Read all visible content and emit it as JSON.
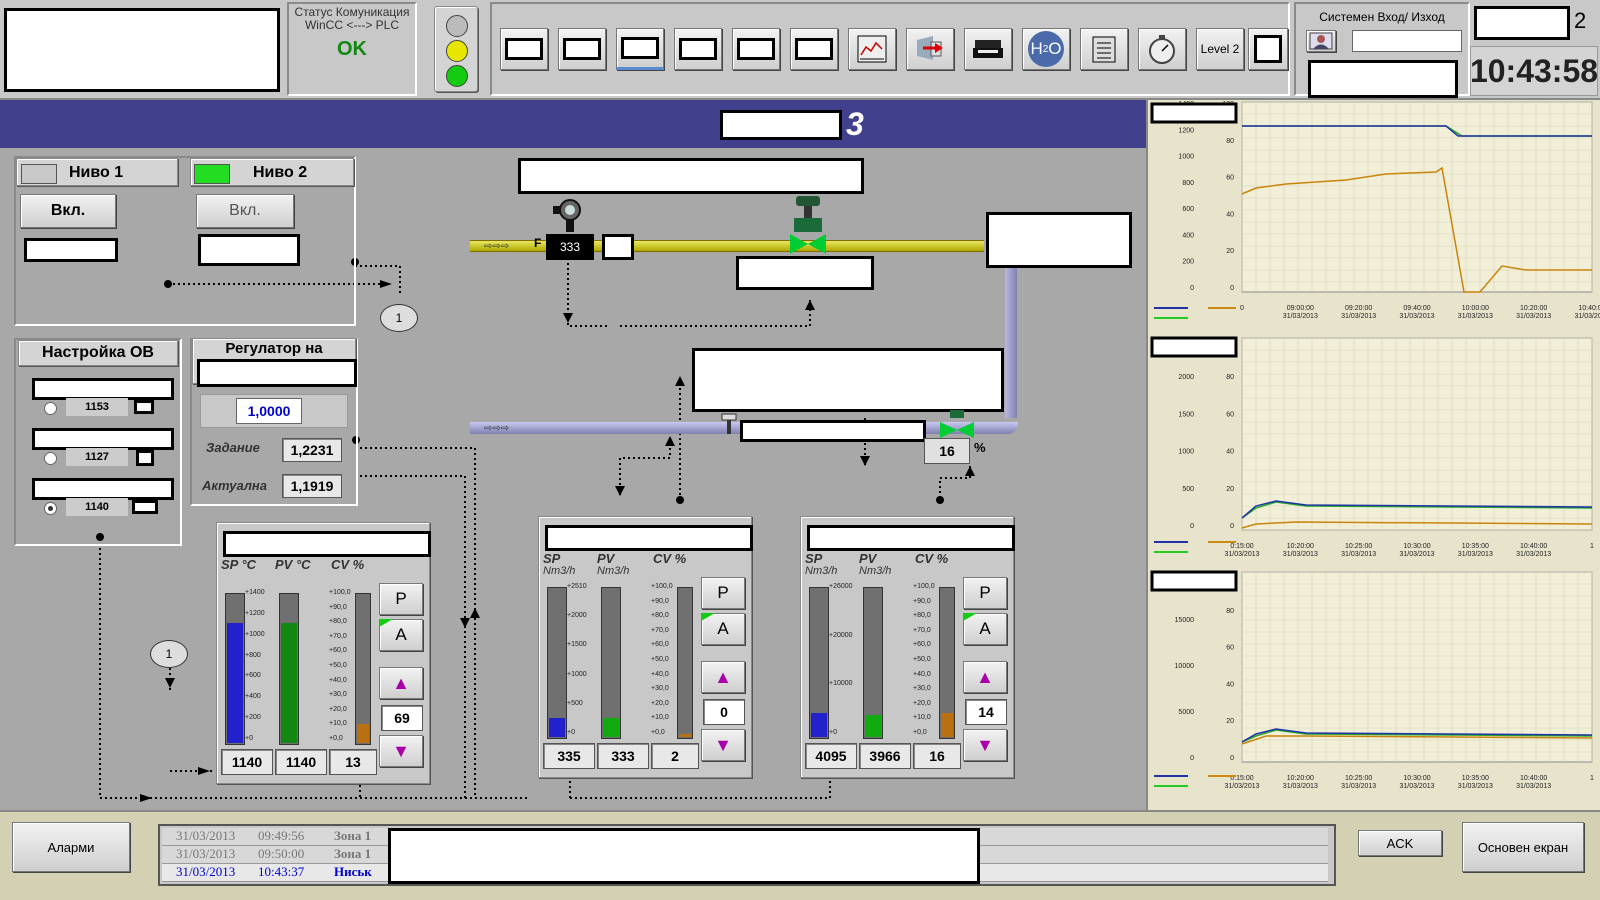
{
  "header": {
    "comm_status_title": "Статус Комуникация WinCC <---> PLC",
    "comm_status_value": "OK",
    "level_button": "Level 2",
    "system_io_label": "Системен Вход/ Изход",
    "station_number": "2",
    "clock": "10:43:58"
  },
  "banner": {
    "number": "3"
  },
  "levels": {
    "level1": {
      "title": "Ниво 1",
      "button": "Вкл.",
      "indicator_color": "#c8c8c8"
    },
    "level2": {
      "title": "Ниво 2",
      "button": "Вкл.",
      "indicator_color": "#22dd22"
    },
    "ref_circle": "1"
  },
  "ov_settings": {
    "title": "Настройка ОВ",
    "options": [
      {
        "value": "1153",
        "selected": false
      },
      {
        "value": "1127",
        "selected": false
      },
      {
        "value": "1140",
        "selected": true
      }
    ]
  },
  "regulator": {
    "title": "Регулатор на",
    "ratio": "1,0000",
    "setpoint_label": "Задание",
    "setpoint_value": "1,2231",
    "actual_label": "Актуална",
    "actual_value": "1,1919"
  },
  "process": {
    "flow_label": "F",
    "flow_value": "333",
    "valve_percent": "16",
    "percent_unit": "%",
    "ref_circle": "1"
  },
  "controllers": [
    {
      "sp_label": "SP °C",
      "pv_label": "PV °C",
      "cv_label": "CV %",
      "sp_unit": "",
      "pv_unit": "",
      "sp_scale": [
        "+1400",
        "+1200",
        "+1000",
        "+800",
        "+600",
        "+400",
        "+200",
        "+0"
      ],
      "cv_scale": [
        "+100,0",
        "+90,0",
        "+80,0",
        "+70,0",
        "+60,0",
        "+50,0",
        "+40,0",
        "+30,0",
        "+20,0",
        "+10,0",
        "+0,0"
      ],
      "sp": "1140",
      "pv": "1140",
      "cv": "13",
      "out": "69",
      "sp_fill": 0.81,
      "pv_fill": 0.81,
      "cv_fill": 0.13,
      "sp_color": "#2222cc",
      "pv_color": "#118811",
      "cv_color": "#b87010",
      "p": "P",
      "a": "A"
    },
    {
      "sp_label": "SP",
      "pv_label": "PV",
      "cv_label": "CV %",
      "sp_unit": "Nm3/h",
      "pv_unit": "Nm3/h",
      "sp_scale": [
        "+2510",
        "+2000",
        "+1500",
        "+1000",
        "+500",
        "+0"
      ],
      "cv_scale": [
        "+100,0",
        "+90,0",
        "+80,0",
        "+70,0",
        "+60,0",
        "+50,0",
        "+40,0",
        "+30,0",
        "+20,0",
        "+10,0",
        "+0,0"
      ],
      "sp": "335",
      "pv": "333",
      "cv": "2",
      "out": "0",
      "sp_fill": 0.13,
      "pv_fill": 0.13,
      "cv_fill": 0.02,
      "sp_color": "#2222cc",
      "pv_color": "#11aa11",
      "cv_color": "#b87010",
      "p": "P",
      "a": "A"
    },
    {
      "sp_label": "SP",
      "pv_label": "PV",
      "cv_label": "CV %",
      "sp_unit": "Nm3/h",
      "pv_unit": "Nm3/h",
      "sp_scale": [
        "+26000",
        "+20000",
        "+10000",
        "+0"
      ],
      "cv_scale": [
        "+100,0",
        "+90,0",
        "+80,0",
        "+70,0",
        "+60,0",
        "+50,0",
        "+40,0",
        "+30,0",
        "+20,0",
        "+10,0",
        "+0,0"
      ],
      "sp": "4095",
      "pv": "3966",
      "cv": "16",
      "out": "14",
      "sp_fill": 0.16,
      "pv_fill": 0.15,
      "cv_fill": 0.16,
      "sp_color": "#2222cc",
      "pv_color": "#11aa11",
      "cv_color": "#b87010",
      "p": "P",
      "a": "A"
    }
  ],
  "trends": [
    {
      "y_ticks": [
        "1400",
        "1200",
        "1000",
        "800",
        "600",
        "400",
        "200",
        "0"
      ],
      "y2_ticks": [
        "100",
        "80",
        "60",
        "40",
        "20",
        "0"
      ],
      "x_ticks": [
        {
          "time": "0",
          "date": ""
        },
        {
          "time": "09:00:00",
          "date": "31/03/2013"
        },
        {
          "time": "09:20:00",
          "date": "31/03/2013"
        },
        {
          "time": "09:40:00",
          "date": "31/03/2013"
        },
        {
          "time": "10:00:00",
          "date": "31/03/2013"
        },
        {
          "time": "10:20:00",
          "date": "31/03/2013"
        },
        {
          "time": "10:40:00",
          "date": "31/03/2013"
        }
      ]
    },
    {
      "y_ticks": [
        "2500",
        "2000",
        "1500",
        "1000",
        "500",
        "0"
      ],
      "y2_ticks": [
        "100",
        "80",
        "60",
        "40",
        "20",
        "0"
      ],
      "x_ticks": [
        {
          "time": "0:15:00",
          "date": "31/03/2013"
        },
        {
          "time": "10:20:00",
          "date": "31/03/2013"
        },
        {
          "time": "10:25:00",
          "date": "31/03/2013"
        },
        {
          "time": "10:30:00",
          "date": "31/03/2013"
        },
        {
          "time": "10:35:00",
          "date": "31/03/2013"
        },
        {
          "time": "10:40:00",
          "date": "31/03/2013"
        },
        {
          "time": "1",
          "date": ""
        }
      ]
    },
    {
      "y_ticks": [
        "20000",
        "15000",
        "10000",
        "5000",
        "0"
      ],
      "y2_ticks": [
        "100",
        "80",
        "60",
        "40",
        "20",
        "0"
      ],
      "x_ticks": [
        {
          "time": "0:15:00",
          "date": "31/03/2013"
        },
        {
          "time": "10:20:00",
          "date": "31/03/2013"
        },
        {
          "time": "10:25:00",
          "date": "31/03/2013"
        },
        {
          "time": "10:30:00",
          "date": "31/03/2013"
        },
        {
          "time": "10:35:00",
          "date": "31/03/2013"
        },
        {
          "time": "10:40:00",
          "date": "31/03/2013"
        },
        {
          "time": "1",
          "date": ""
        }
      ]
    }
  ],
  "footer": {
    "alarms_button": "Аларми",
    "ack_button": "ACK",
    "main_screen_button": "Основен екран",
    "events": [
      {
        "date": "31/03/2013",
        "time": "09:49:56",
        "zone": "Зона 1",
        "active": false
      },
      {
        "date": "31/03/2013",
        "time": "09:50:00",
        "zone": "Зона 1",
        "active": false
      },
      {
        "date": "31/03/2013",
        "time": "10:43:37",
        "zone": "Ниськ",
        "active": true
      }
    ]
  },
  "colors": {
    "banner": "#40408c",
    "status_ok": "#118811",
    "pipe_gas": "#c8c820",
    "pipe_air": "#9a9ac8"
  }
}
